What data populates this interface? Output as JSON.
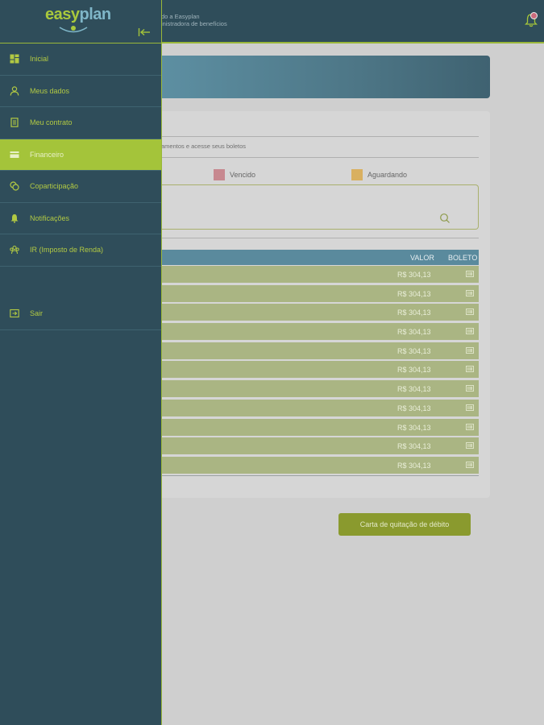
{
  "header": {
    "welcome_line1": "do a Easyplan",
    "welcome_line2": "inistradora de benefícios",
    "notification_icon": "bell-icon"
  },
  "brand": {
    "easy": "easy",
    "plan": "plan"
  },
  "colors": {
    "sidebar_bg": "#2f4d5a",
    "accent_green": "#a4c43a",
    "table_header": "#5a8a9d",
    "row_bg": "#aab583",
    "vencido": "#c7888f",
    "aguardando": "#d9b060",
    "button": "#8a9a2e"
  },
  "sidebar": {
    "items": [
      {
        "label": "Inicial",
        "icon": "dashboard-icon"
      },
      {
        "label": "Meus dados",
        "icon": "user-icon"
      },
      {
        "label": "Meu contrato",
        "icon": "document-icon"
      },
      {
        "label": "Financeiro",
        "icon": "card-icon",
        "active": true
      },
      {
        "label": "Coparticipação",
        "icon": "coins-icon"
      },
      {
        "label": "Notificações",
        "icon": "bell-icon"
      },
      {
        "label": "IR (Imposto de Renda)",
        "icon": "group-icon"
      }
    ],
    "logout": {
      "label": "Sair",
      "icon": "logout-icon"
    }
  },
  "main": {
    "subtitle": "amentos e acesse seus boletos",
    "legend": {
      "vencido": "Vencido",
      "aguardando": "Aguardando"
    },
    "table": {
      "col_valor": "VALOR",
      "col_boleto": "BOLETO",
      "rows": [
        {
          "valor": "R$ 304,13"
        },
        {
          "valor": "R$ 304,13"
        },
        {
          "valor": "R$ 304,13"
        },
        {
          "valor": "R$ 304,13"
        },
        {
          "valor": "R$ 304,13"
        },
        {
          "valor": "R$ 304,13"
        },
        {
          "valor": "R$ 304,13"
        },
        {
          "valor": "R$ 304,13"
        },
        {
          "valor": "R$ 304,13"
        },
        {
          "valor": "R$ 304,13"
        },
        {
          "valor": "R$ 304,13"
        }
      ]
    },
    "carta_button": "Carta de quitação de débito"
  }
}
